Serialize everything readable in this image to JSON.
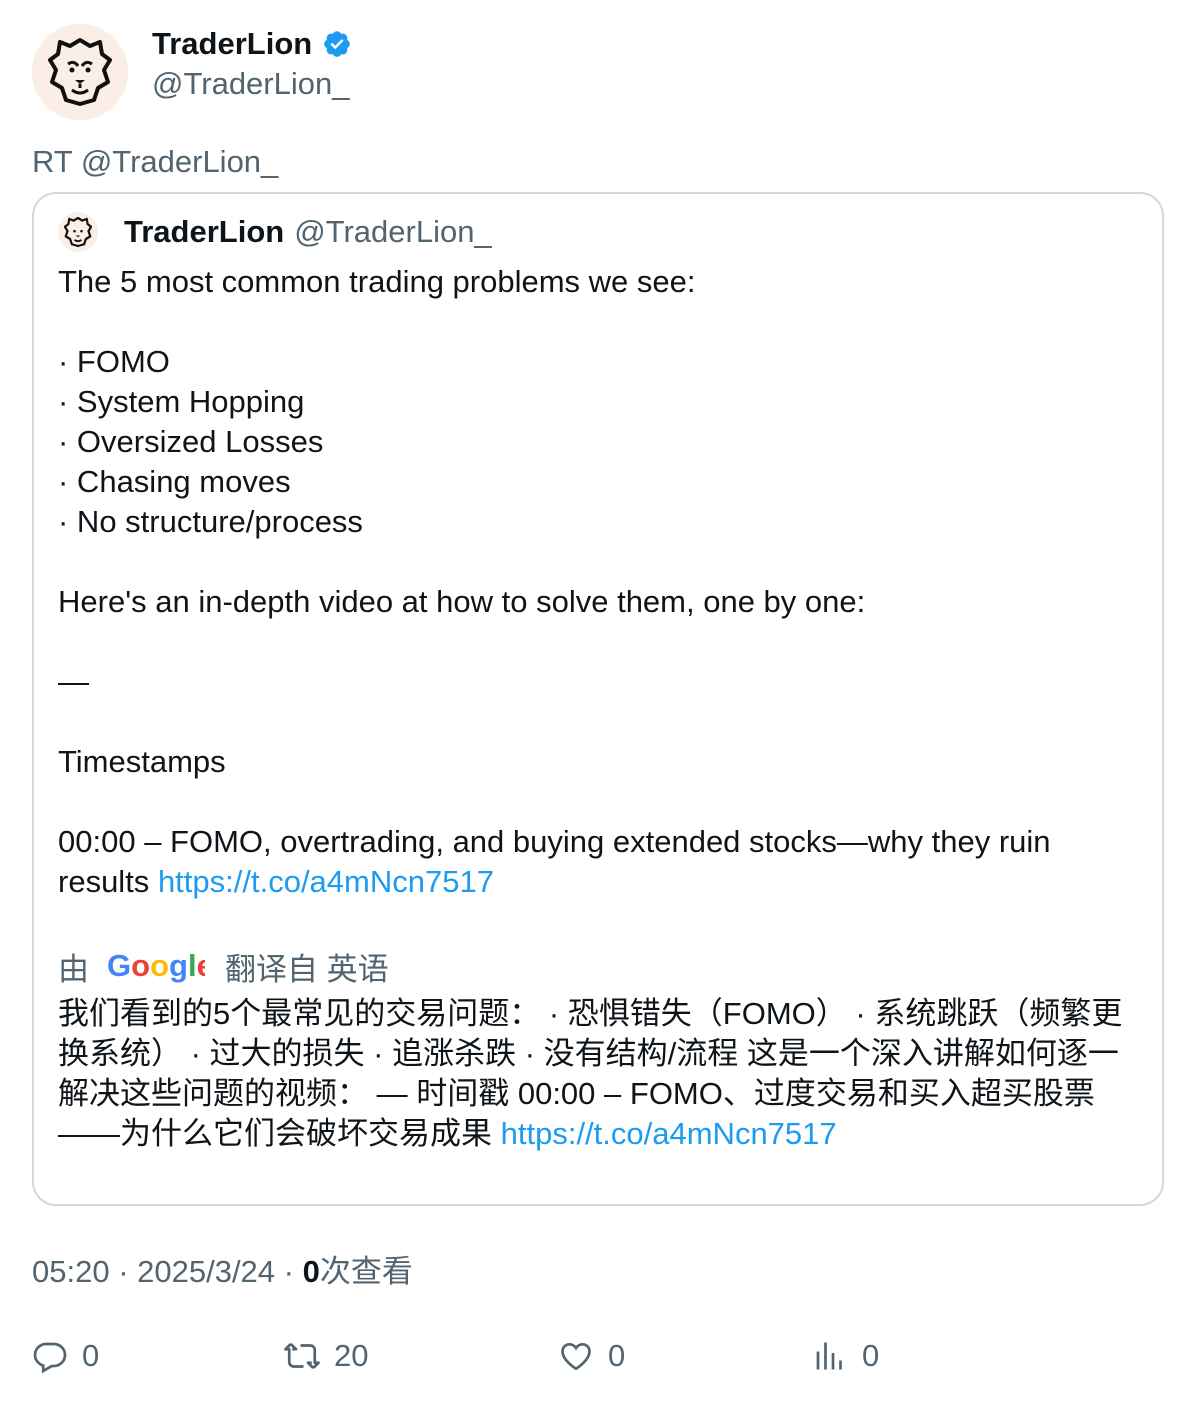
{
  "author": {
    "name": "TraderLion",
    "handle": "@TraderLion_",
    "verified_icon": "verified-badge-icon",
    "accent": "#1d9bf0"
  },
  "retweet_line": "RT @TraderLion_",
  "quote": {
    "name": "TraderLion",
    "handle": "@TraderLion_",
    "lines": {
      "intro": "The 5 most common trading problems we see:",
      "item1": "· FOMO",
      "item2": "· System Hopping",
      "item3": "· Oversized Losses",
      "item4": "· Chasing moves",
      "item5": "· No structure/process",
      "video": "Here's an in-depth video at how to solve them, one by one:",
      "dash": "—",
      "timestamps": "Timestamps",
      "ts1": "00:00 – FOMO, overtrading, and buying extended stocks—why they ruin results",
      "link": "https://t.co/a4mNcn7517"
    },
    "translate": {
      "by": "由",
      "translated_from": "翻译自 英语"
    },
    "translated_text": "我们看到的5个最常见的交易问题： · 恐惧错失（FOMO） · 系统跳跃（频繁更换系统） · 过大的损失 · 追涨杀跌 · 没有结构/流程 这是一个深入讲解如何逐一解决这些问题的视频： — 时间戳 00:00 – FOMO、过度交易和买入超买股票——为什么它们会破坏交易成果",
    "translated_link": "https://t.co/a4mNcn7517"
  },
  "meta": {
    "time": "05:20 · 2025/3/24 · ",
    "views_count": "0",
    "views_label": "次查看"
  },
  "actions": {
    "replies": "0",
    "retweets": "20",
    "likes": "0",
    "views": "0"
  }
}
